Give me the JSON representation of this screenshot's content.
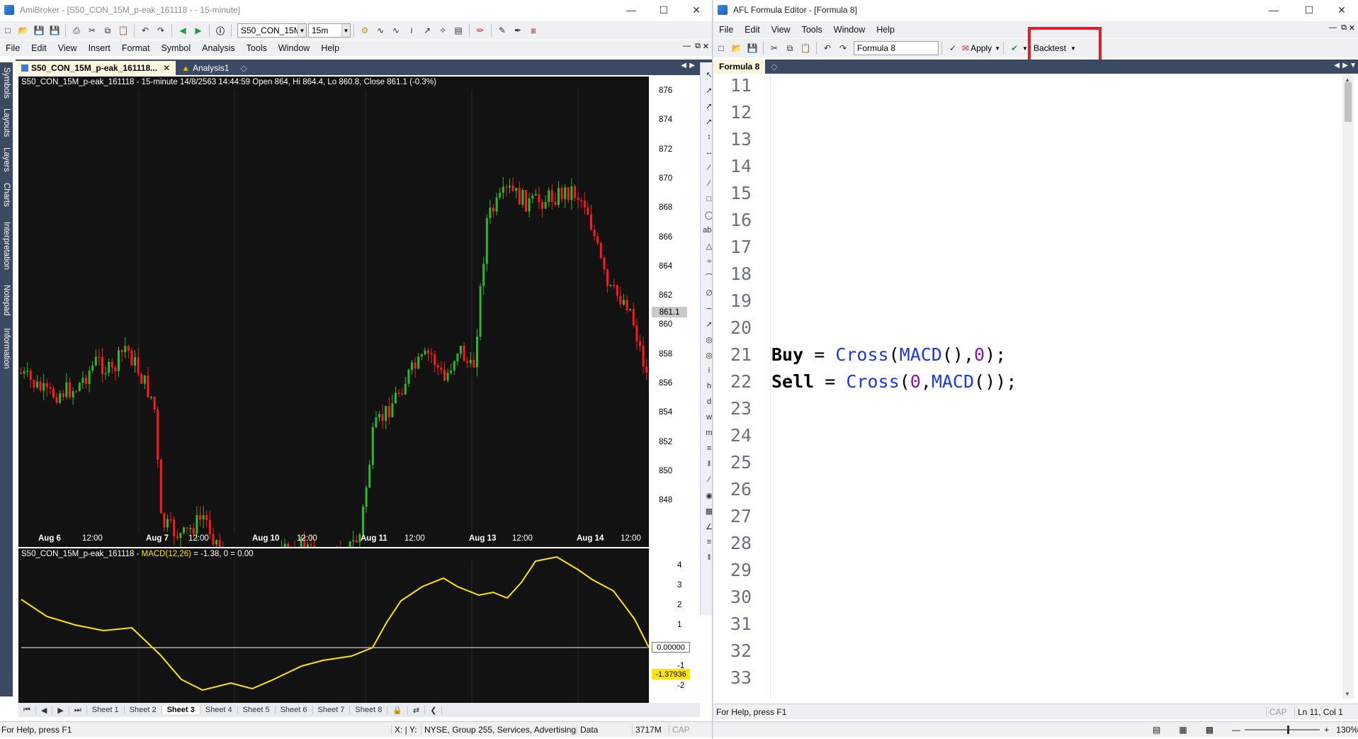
{
  "colors": {
    "bull": "#2db82d",
    "bear": "#ff1a1a",
    "macd": "#ffe600",
    "chart_bg": "#121212",
    "highlight": "#e41d2a",
    "tab_bg": "#3b4a63"
  },
  "amibroker": {
    "title": "AmiBroker - [S50_CON_15M_p-eak_161118 -  - 15-minute]",
    "menu": [
      "File",
      "Edit",
      "View",
      "Insert",
      "Format",
      "Symbol",
      "Analysis",
      "Tools",
      "Window",
      "Help"
    ],
    "symbol_combo": "S50_CON_15M",
    "interval_combo": "15m",
    "tabs": [
      "S50_CON_15M_p-eak_161118...",
      "Analysis1"
    ],
    "side_tabs": [
      "Symbols",
      "Layouts",
      "Layers",
      "Charts",
      "Interpretation",
      "Notepad",
      "Information"
    ],
    "price_header": "S50_CON_15M_p-eak_161118 - 15-minute 14/8/2563 14:44:59 Open 864, Hi 864.4, Lo 860.8, Close 861.1 (-0.3%)",
    "macd_header_prefix": "S50_CON_15M_p-eak_161118 - ",
    "macd_header_name": "MACD(12,26)",
    "macd_header_suffix": " = -1.38, 0 = 0.00",
    "price_axis": [
      "876",
      "874",
      "872",
      "870",
      "868",
      "866",
      "864",
      "862",
      "860",
      "858",
      "856",
      "854",
      "852",
      "850",
      "848"
    ],
    "last_price_label": "861.1",
    "date_labels": [
      {
        "text": "Aug 6",
        "bold": true
      },
      {
        "text": "12:00",
        "bold": false
      },
      {
        "text": "Aug 7",
        "bold": true
      },
      {
        "text": "12:00",
        "bold": false
      },
      {
        "text": "Aug 10",
        "bold": true
      },
      {
        "text": "12:00",
        "bold": false
      },
      {
        "text": "Aug 11",
        "bold": true
      },
      {
        "text": "12:00",
        "bold": false
      },
      {
        "text": "Aug 13",
        "bold": true
      },
      {
        "text": "12:00",
        "bold": false
      },
      {
        "text": "Aug 14",
        "bold": true
      },
      {
        "text": "12:00",
        "bold": false
      }
    ],
    "macd_axis": [
      "4",
      "3",
      "2",
      "1",
      "-1",
      "-2"
    ],
    "zero_label": "0.00000",
    "macd_value_label": "-1.37936",
    "sheets": [
      "Sheet 1",
      "Sheet 2",
      "Sheet 3",
      "Sheet 4",
      "Sheet 5",
      "Sheet 6",
      "Sheet 7",
      "Sheet 8"
    ],
    "active_sheet": "Sheet 3",
    "status": {
      "help": "For Help, press F1",
      "xy": "X: | Y:",
      "market": "NYSE, Group 255, Services, Advertising",
      "data": "Data",
      "memory": "3717M",
      "cap": "CAP"
    }
  },
  "afl_editor": {
    "title": "AFL Formula Editor - [Formula 8]",
    "menu": [
      "File",
      "Edit",
      "View",
      "Tools",
      "Window",
      "Help"
    ],
    "formula_name": "Formula 8",
    "apply_label": "Apply",
    "backtest_label": "Backtest",
    "tab_label": "Formula 8",
    "line_numbers": [
      "11",
      "12",
      "13",
      "14",
      "15",
      "16",
      "17",
      "18",
      "19",
      "20",
      "21",
      "22",
      "23",
      "24",
      "25",
      "26",
      "27",
      "28",
      "29",
      "30",
      "31",
      "32",
      "33"
    ],
    "code": {
      "buy_kw": "Buy",
      "sell_kw": "Sell",
      "eq": " = ",
      "cross": "Cross",
      "macd": "MACD",
      "zero": "0",
      "buy_rest_open": "(",
      "buy_rest_mid": "(),",
      "buy_rest_close": ");",
      "sell_open": "(",
      "sell_mid": ",",
      "sell_close": "());"
    },
    "status": {
      "help": "For Help, press F1",
      "cap": "CAP",
      "position": "Ln 11, Col 1",
      "zoom": "130%"
    }
  }
}
